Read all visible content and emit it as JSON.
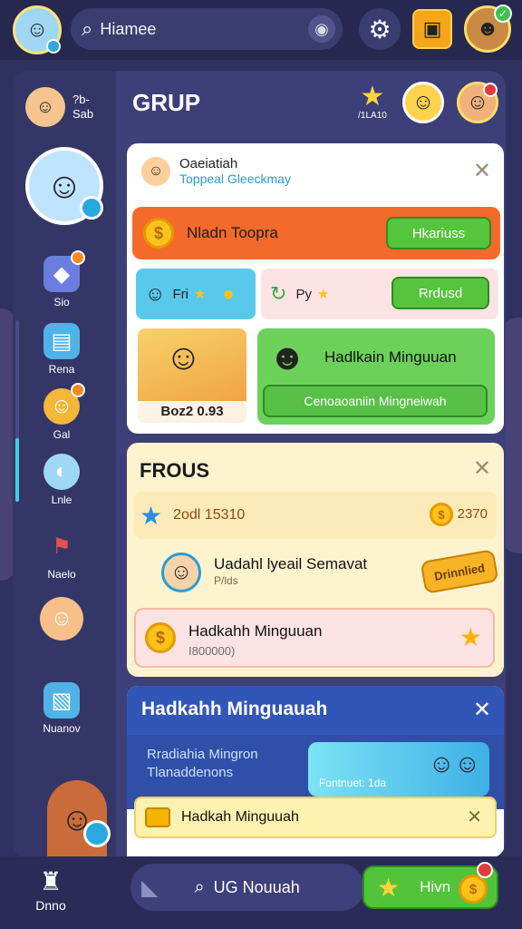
{
  "topbar": {
    "search_label": "Hiamee",
    "search_icon": "search-icon",
    "mic_icon": "mic-icon",
    "settings_icon": "gear-icon"
  },
  "sidebar": {
    "header_text_1": "?b-",
    "header_text_2": "Sab",
    "items": [
      {
        "label": "Sio",
        "icon": "gem-icon"
      },
      {
        "label": "Rena",
        "icon": "chat-icon"
      },
      {
        "label": "Gal",
        "icon": "smile-icon"
      },
      {
        "label": "Lnle",
        "icon": "fish-icon"
      },
      {
        "label": "Naelo",
        "icon": "flag-icon"
      },
      {
        "label": "Nuanov",
        "icon": "card-icon"
      }
    ]
  },
  "main": {
    "title": "GRUP",
    "star_label": "/1LA10"
  },
  "card1": {
    "name": "Oaeiatiah",
    "subtitle": "Toppeal Gleeckmay",
    "orange_label": "Nladn Toopra",
    "orange_button": "Hkariuss",
    "blue_mini_label": "Fri",
    "pink_mini_label": "Py",
    "pink_mini_button": "Rrdusd",
    "game_label": "Boz2 0.93",
    "green_title": "Hadlkain Minguuan",
    "green_button": "Cenoaoaniin Mingneiwah"
  },
  "card2": {
    "title": "FROUS",
    "row1_label": "2odl 15310",
    "row1_value": "2370",
    "row2_title": "Uadahl lyeail Semavat",
    "row2_sub": "P/lds",
    "row2_pill": "Drinnlied",
    "row3_title": "Hadkahh Minguuan",
    "row3_sub": "I800000)"
  },
  "card3": {
    "title": "Hadkahh Minguauah",
    "body_line1": "Rradiahia Mingron",
    "body_line2": "Tlanaddenons",
    "thumb_label": "Fontnuet: 1da",
    "yellow_row": "Hadkah Minguuah"
  },
  "bottombar": {
    "home_label": "Dnno",
    "search_label": "UG Nouuah",
    "green_label": "Hivn"
  },
  "colors": {
    "background": "#2f3160",
    "panel": "#3d3f79",
    "orange": "#f36a2a",
    "green": "#57c43d",
    "blue_header": "#3256b8"
  }
}
